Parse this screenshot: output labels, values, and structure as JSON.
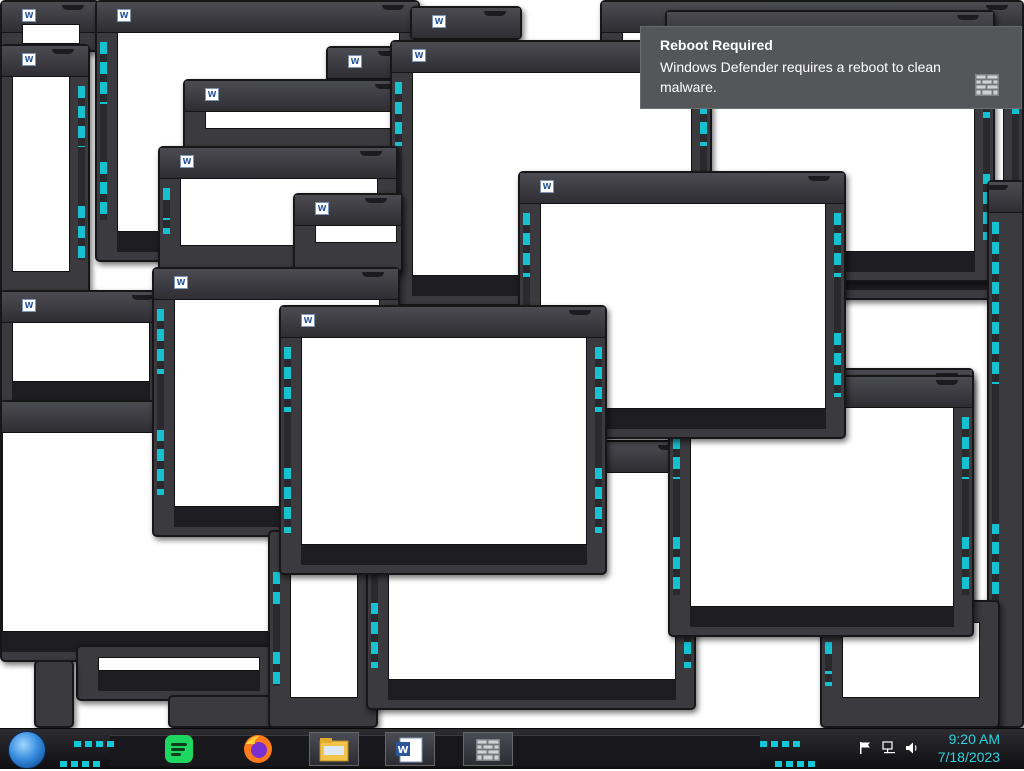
{
  "notification": {
    "title": "Reboot Required",
    "message": "Windows Defender requires a reboot to clean malware.",
    "icon": "defender-wall-icon"
  },
  "desktop": {
    "window_icon": "word-document-icon",
    "window_count": 22
  },
  "taskbar": {
    "start_icon": "windows-orb-icon",
    "pinned": [
      {
        "name": "spotify",
        "icon": "spotify-icon"
      },
      {
        "name": "firefox",
        "icon": "firefox-icon"
      },
      {
        "name": "file-explorer",
        "icon": "file-explorer-icon"
      },
      {
        "name": "word",
        "icon": "word-icon"
      },
      {
        "name": "defender",
        "icon": "defender-wall-icon"
      }
    ],
    "tray_icons": [
      "action-center-flag-icon",
      "network-icon",
      "volume-icon"
    ],
    "clock": {
      "time": "9:20 AM",
      "date": "7/18/2023"
    }
  },
  "colors": {
    "accent": "#14c8d8",
    "frame": "#3a3a3f",
    "toast": "#545659"
  }
}
